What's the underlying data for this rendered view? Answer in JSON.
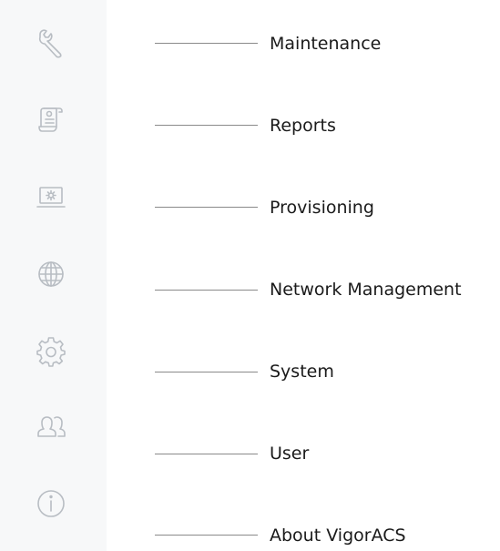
{
  "menu": [
    {
      "label": "Maintenance",
      "icon": "wrench-icon"
    },
    {
      "label": "Reports",
      "icon": "report-scroll-icon"
    },
    {
      "label": "Provisioning",
      "icon": "provisioning-laptop-icon"
    },
    {
      "label": "Network Management",
      "icon": "globe-icon"
    },
    {
      "label": "System",
      "icon": "gear-icon"
    },
    {
      "label": "User",
      "icon": "users-icon"
    },
    {
      "label": "About VigorACS",
      "icon": "info-icon"
    }
  ],
  "colors": {
    "sidebar_bg": "#f7f8f9",
    "icon_stroke": "#b8bdc3",
    "callout_line": "#8a8a8a",
    "label_text": "#1a1a1a"
  }
}
